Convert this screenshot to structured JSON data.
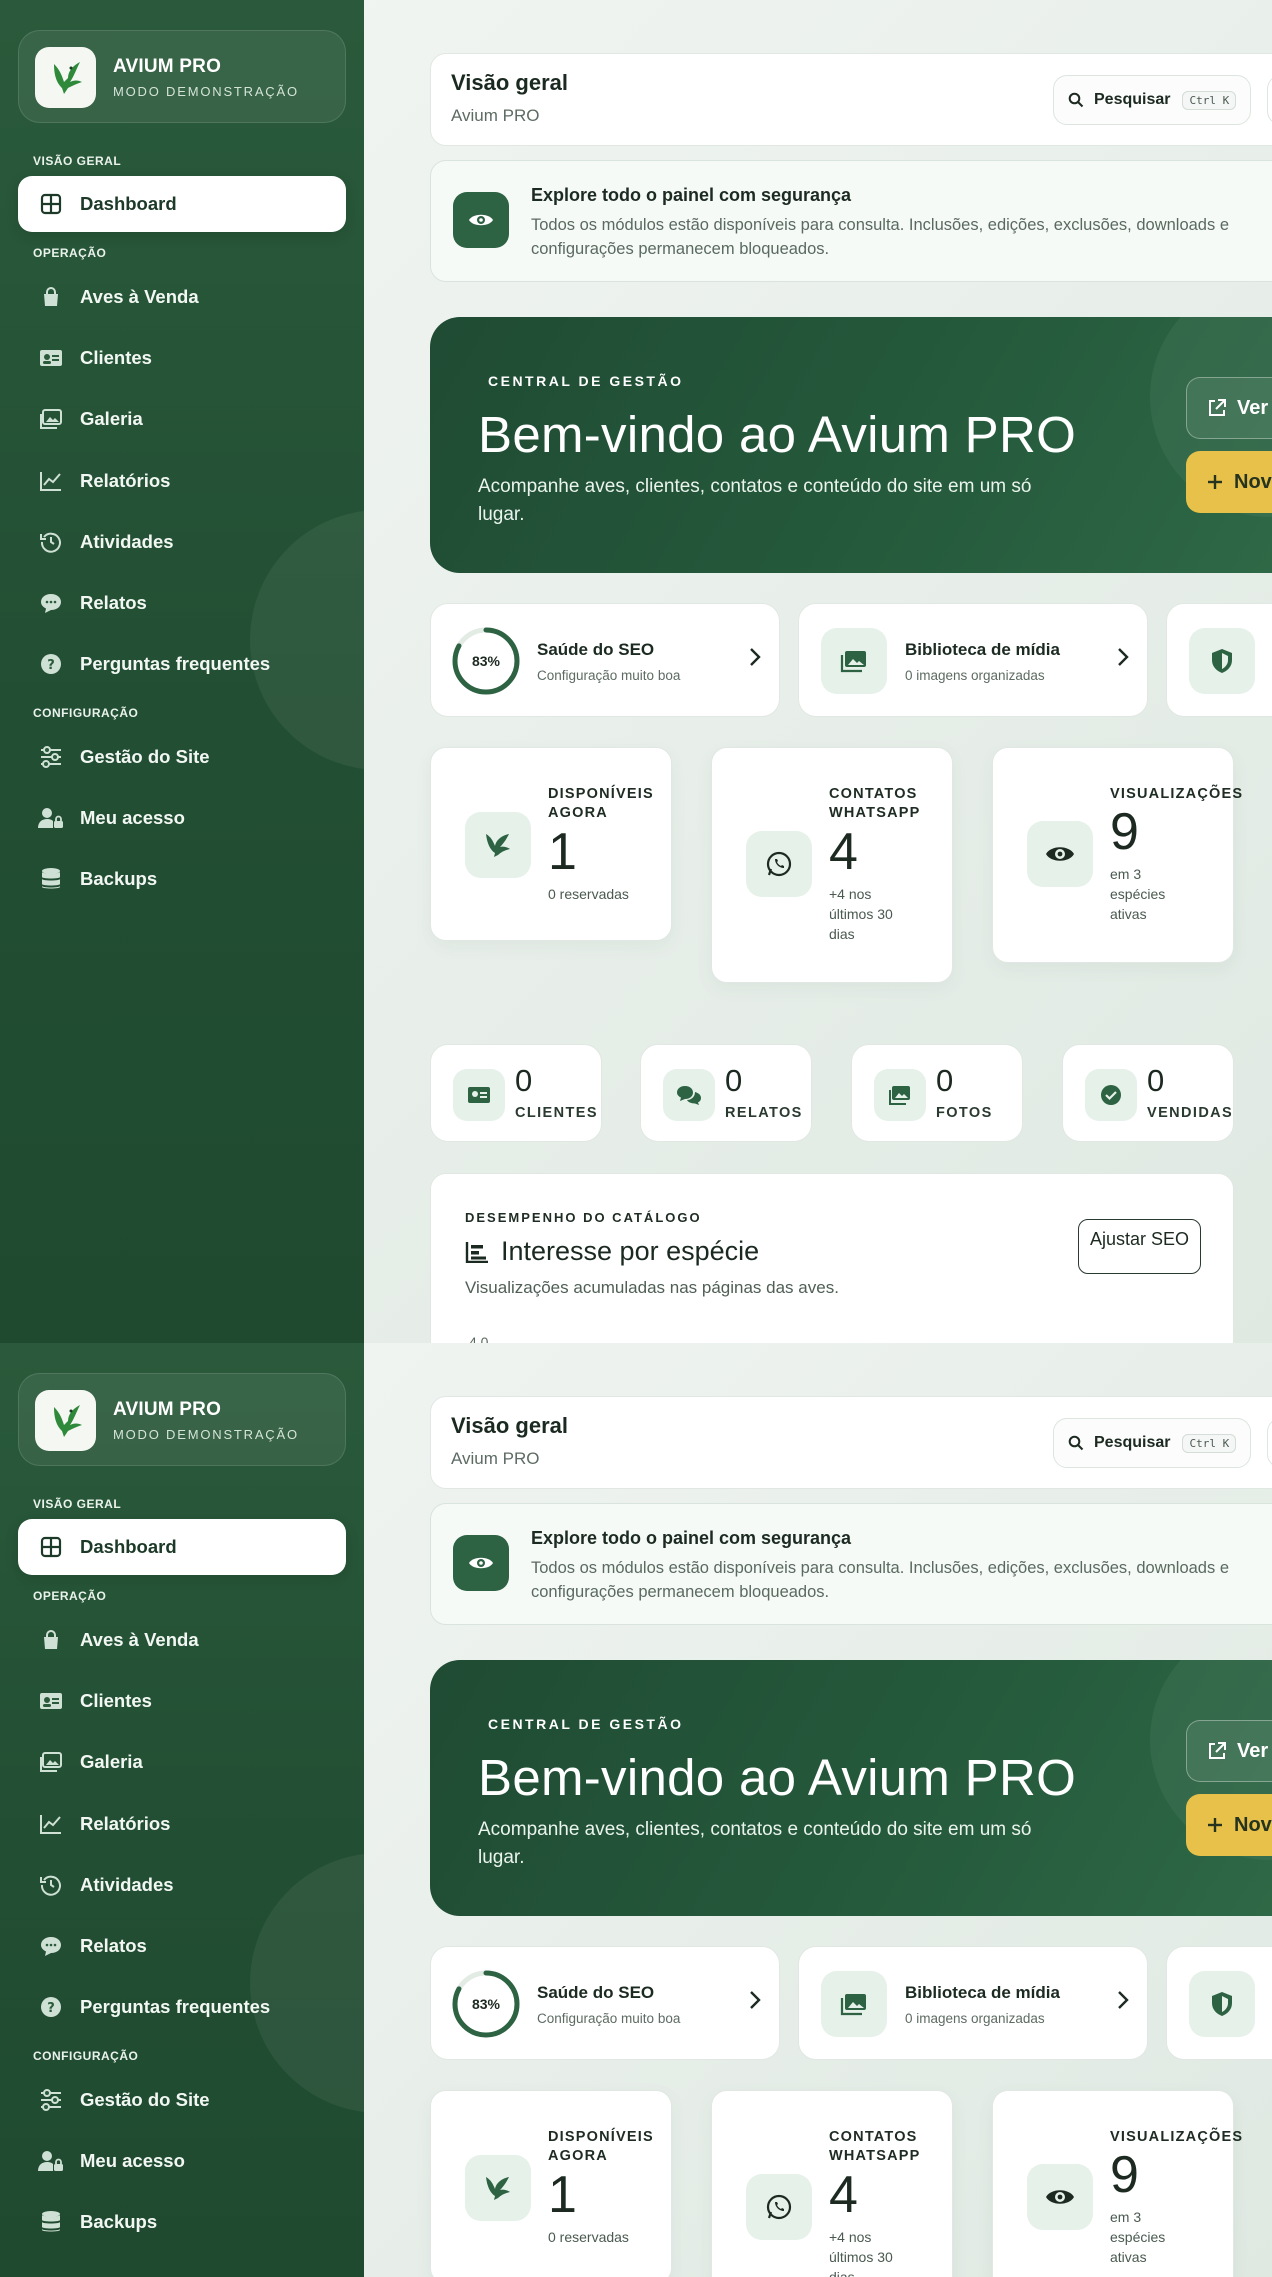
{
  "brand": {
    "name": "AVIUM PRO",
    "subtitle": "MODO DEMONSTRAÇÃO"
  },
  "sidebar": {
    "sections": [
      {
        "label": "VISÃO GERAL"
      },
      {
        "label": "OPERAÇÃO"
      },
      {
        "label": "CONFIGURAÇÃO"
      }
    ],
    "items": [
      {
        "label": "Dashboard",
        "icon": "dashboard-icon"
      },
      {
        "label": "Aves à Venda",
        "icon": "shopping-bag-icon"
      },
      {
        "label": "Clientes",
        "icon": "contact-card-icon"
      },
      {
        "label": "Galeria",
        "icon": "image-icon"
      },
      {
        "label": "Relatórios",
        "icon": "line-chart-icon"
      },
      {
        "label": "Atividades",
        "icon": "history-icon"
      },
      {
        "label": "Relatos",
        "icon": "chat-icon"
      },
      {
        "label": "Perguntas frequentes",
        "icon": "help-icon"
      },
      {
        "label": "Gestão do Site",
        "icon": "sliders-icon"
      },
      {
        "label": "Meu acesso",
        "icon": "user-lock-icon"
      },
      {
        "label": "Backups",
        "icon": "database-icon"
      }
    ]
  },
  "header": {
    "title": "Visão geral",
    "subtitle": "Avium PRO",
    "search_label": "Pesquisar",
    "search_shortcut": "Ctrl K"
  },
  "notice": {
    "title": "Explore todo o painel com segurança",
    "text": "Todos os módulos estão disponíveis para consulta. Inclusões, edições, exclusões, downloads e configurações permanecem bloqueados."
  },
  "hero": {
    "kicker": "CENTRAL DE GESTÃO",
    "title": "Bem-vindo ao Avium PRO",
    "description": "Acompanhe aves, clientes, contatos e conteúdo do site em um só lugar.",
    "btn_view_site": "Ver site",
    "btn_new": "Nova ave"
  },
  "quick": [
    {
      "title": "Saúde do SEO",
      "subtitle": "Configuração muito boa",
      "value": "83%",
      "percent": 83
    },
    {
      "title": "Biblioteca de mídia",
      "subtitle": "0 imagens organizadas"
    },
    {
      "title": "",
      "subtitle": ""
    }
  ],
  "stats": [
    {
      "label": "DISPONÍVEIS AGORA",
      "value": "1",
      "desc": "0 reservadas"
    },
    {
      "label": "CONTATOS WHATSAPP",
      "value": "4",
      "desc": "+4 nos últimos 30 dias"
    },
    {
      "label": "VISUALIZAÇÕES",
      "value": "9",
      "desc": "em 3 espécies ativas"
    }
  ],
  "mini": [
    {
      "value": "0",
      "label": "CLIENTES"
    },
    {
      "value": "0",
      "label": "RELATOS"
    },
    {
      "value": "0",
      "label": "FOTOS"
    },
    {
      "value": "0",
      "label": "VENDIDAS"
    }
  ],
  "performance": {
    "kicker": "DESEMPENHO DO CATÁLOGO",
    "title": "Interesse por espécie",
    "description": "Visualizações acumuladas nas páginas das aves.",
    "button": "Ajustar SEO",
    "first_tick": "4.0"
  },
  "colors": {
    "sidebar": "#2a5a3b",
    "accent": "#2d6242",
    "gold": "#e7c14a"
  }
}
